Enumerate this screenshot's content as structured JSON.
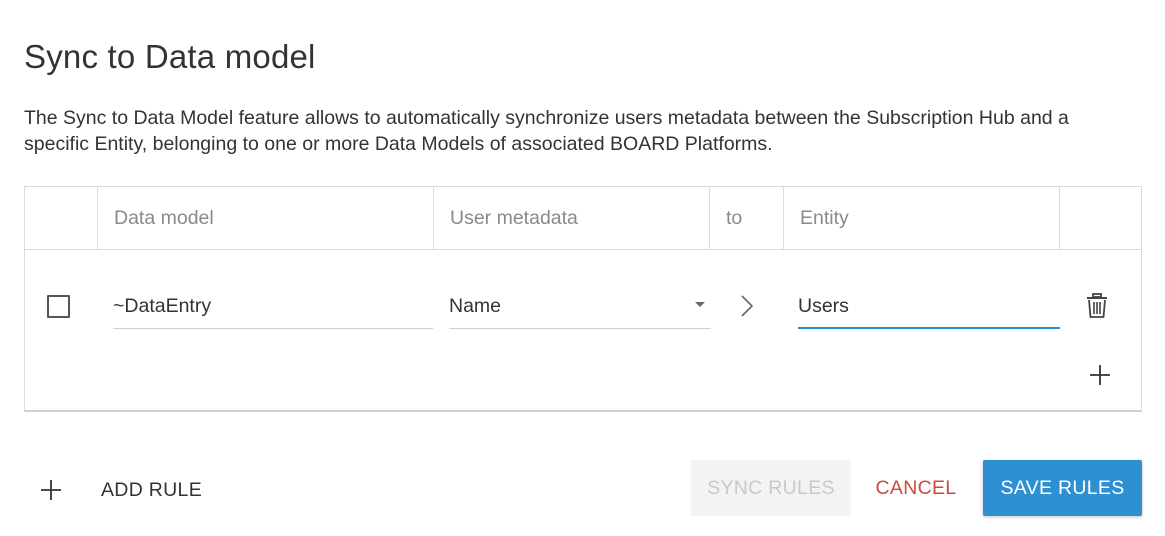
{
  "dialog": {
    "title": "Sync to Data model",
    "description": "The Sync to Data Model feature allows to automatically synchronize users metadata between the Subscription Hub and a specific Entity, belonging to one or more Data Models of associated BOARD Platforms."
  },
  "table": {
    "headers": [
      "",
      "Data model",
      "User metadata",
      "to",
      "Entity",
      ""
    ],
    "rows": [
      {
        "checked": false,
        "data_model": "~DataEntry",
        "user_metadata": "Name",
        "entity": "Users"
      }
    ]
  },
  "actions": {
    "add_rule_label": "ADD RULE",
    "sync_rules_label": "SYNC RULES",
    "cancel_label": "CANCEL",
    "save_rules_label": "SAVE RULES"
  },
  "colors": {
    "accent": "#2e8fd3",
    "cancel": "#cc4b3c",
    "disabled_text": "#c9c9c9"
  },
  "icons": {
    "row_arrow": "chevron-right-icon",
    "delete": "trash-icon",
    "add": "plus-icon",
    "dropdown": "caret-down-icon"
  }
}
